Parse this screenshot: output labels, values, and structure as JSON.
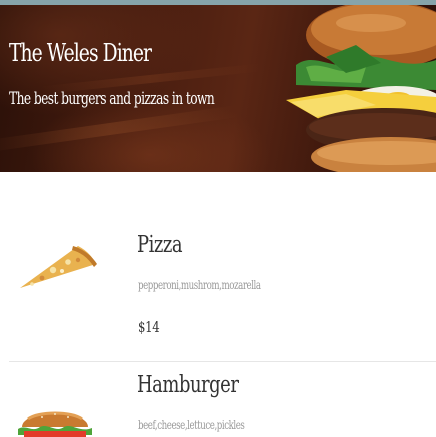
{
  "header": {
    "title": "The Weles Diner",
    "subtitle": "The best burgers and pizzas in town"
  },
  "menu": {
    "items": [
      {
        "name": "Pizza",
        "description": "pepperoni,mushrom,mozarella",
        "price": "$14",
        "icon": "pizza-slice-icon"
      },
      {
        "name": "Hamburger",
        "description": "beef,cheese,lettuce,pickles",
        "icon": "hamburger-icon"
      }
    ]
  },
  "colors": {
    "top_bar": "#86a4aa",
    "hero_background": "#3e1a0e",
    "text_dark": "#333333",
    "text_muted": "#9a9a9a",
    "divider": "#e6e6e6"
  }
}
